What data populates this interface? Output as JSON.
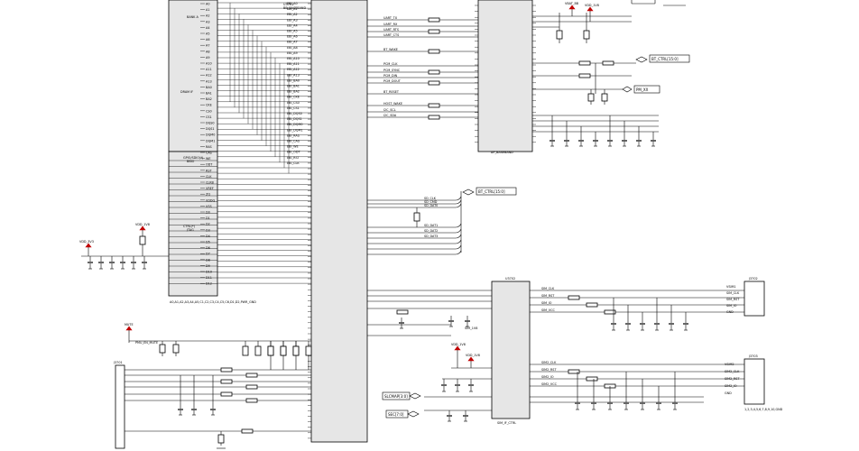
{
  "net_tags": {
    "bt_ctrl_a": "BT_CTRL[15:0]",
    "bt_ctrl_b": "BT_CTRL[15:0]",
    "bt_ctrl_c": "BT_CTRL[15:0]",
    "pm_xx": "PM_XX",
    "slcmap": "SLCMAP[3:0]",
    "sec": "SEC[7:0]"
  },
  "rails": {
    "vdd_1v8_a": "VDD_1V8",
    "vdd_1v8_b": "VDD_1V8",
    "vdd_1v8_c": "VDD_1V8",
    "vdd_1v8_d": "VDD_1V8",
    "vdd_3v3": "VDD_3V3",
    "vbat": "VBAT_BB"
  },
  "chips": {
    "u3700": "U3700",
    "u3700_sub": "AP_BASEBAND",
    "u3701": "U3701",
    "u3701_sub": "BB_BASEBAND",
    "u3702": "U3702",
    "u3702_sub": "SIM_IF_CTRL",
    "j3701": "J3701",
    "j3702": "J3702",
    "j3703": "J3703"
  },
  "labels": {
    "bank_a": "BANK A",
    "bank_b": "DRAM IF",
    "gpio_block": "GPIO/SDIO(*)",
    "gpio_block2": "BBIO",
    "ctrl_block": "CTRL(*)",
    "ctrl_block2": "JTAG",
    "bottom_note": "A0,A1,A2,A3,A4,A5,C1,C2,C3,C4,C5,C6,D1,D2,PWR_GND",
    "conn_note": "1,2,3,4,5,6,7,8,9,10,GND",
    "mute": "MUTE",
    "mute_sub": "PMU_EN_MUTE",
    "sim_label": "SIM_1V8"
  },
  "left_pins": [
    "A0",
    "A1",
    "A2",
    "A3",
    "A4",
    "A5",
    "A6",
    "A7",
    "A8",
    "A9",
    "A10",
    "A11",
    "A12",
    "A13",
    "BA0",
    "BA1",
    "BA2",
    "CKE",
    "CS0",
    "CS1",
    "DQS0",
    "DQS1",
    "DQM0",
    "DQM1",
    "RAS",
    "CAS",
    "WE",
    "ODT",
    "RST",
    "CLK",
    "CLKB",
    "VREF",
    "ZQ",
    "VDDQ",
    "VSS",
    "D0",
    "D1",
    "D2",
    "D3",
    "D4",
    "D5",
    "D6",
    "D7",
    "D8",
    "D9",
    "D10",
    "D11",
    "D12"
  ],
  "bus_nets": [
    "EBI_A0",
    "EBI_A1",
    "EBI_A2",
    "EBI_A3",
    "EBI_A4",
    "EBI_A5",
    "EBI_A6",
    "EBI_A7",
    "EBI_A8",
    "EBI_A9",
    "EBI_A10",
    "EBI_A11",
    "EBI_A12",
    "EBI_A13",
    "EBI_BA0",
    "EBI_BA1",
    "EBI_BA2",
    "EBI_CKE",
    "EBI_CS0",
    "EBI_CS1",
    "EBI_DQS0",
    "EBI_DQS1",
    "EBI_DQM0",
    "EBI_DQM1",
    "EBI_RAS",
    "EBI_CAS",
    "EBI_WE",
    "EBI_ODT",
    "EBI_RST",
    "EBI_CLK"
  ],
  "mid_signals": [
    "UART_TX",
    "UART_RX",
    "UART_RTS",
    "UART_CTS",
    "BT_WAKE",
    "PCM_CLK",
    "PCM_SYNC",
    "PCM_DIN",
    "PCM_DOUT",
    "BT_RESET",
    "HOST_WAKE",
    "I2C_SCL",
    "I2C_SDA"
  ],
  "mid_pins": [
    "UART_TXD",
    "UART_RXD",
    "UART_RTS",
    "UART_CTS",
    "HOST_WAKE",
    "PCM_CLK",
    "PCM_SYNC",
    "PCM_IN",
    "PCM_OUT",
    "BT_RST_N",
    "BT_WAKE",
    "SLEEP_CLK",
    "REG_ON"
  ],
  "sdio_nets": [
    "SD_CLK",
    "SD_CMD",
    "SD_DAT0",
    "SD_DAT1",
    "SD_DAT2",
    "SD_DAT3"
  ],
  "sim_nets": [
    "SIM_CLK",
    "SIM_RST",
    "SIM_IO",
    "SIM_VCC"
  ],
  "sim_nets2": [
    "SIM2_CLK",
    "SIM2_RST",
    "SIM2_IO",
    "SIM2_VCC"
  ],
  "conn_pins": [
    "VSIM1",
    "SIM_CLK",
    "SIM_RST",
    "SIM_IO",
    "GND"
  ],
  "conn_pins2": [
    "VSIM2",
    "SIM2_CLK",
    "SIM2_RST",
    "SIM2_IO",
    "GND"
  ]
}
